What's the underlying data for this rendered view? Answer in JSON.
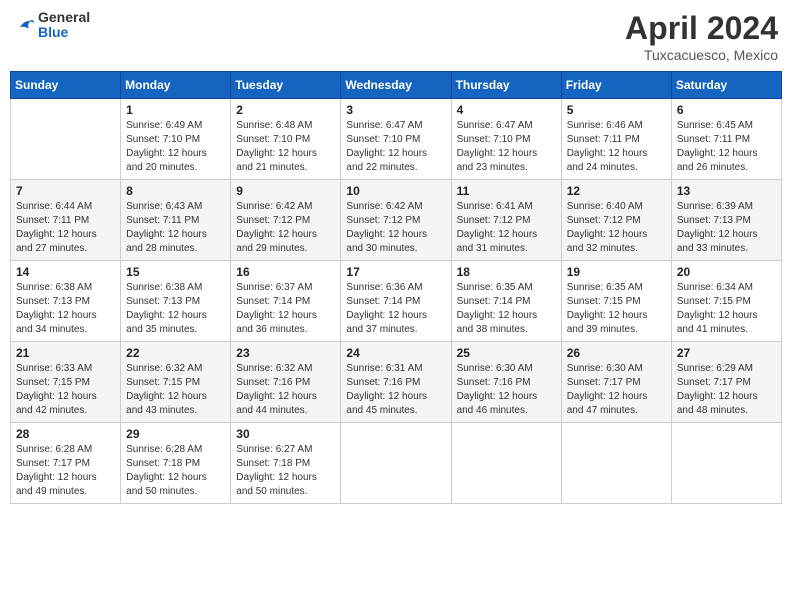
{
  "header": {
    "logo_general": "General",
    "logo_blue": "Blue",
    "month": "April 2024",
    "location": "Tuxcacuesco, Mexico"
  },
  "weekdays": [
    "Sunday",
    "Monday",
    "Tuesday",
    "Wednesday",
    "Thursday",
    "Friday",
    "Saturday"
  ],
  "weeks": [
    [
      {
        "day": "",
        "info": ""
      },
      {
        "day": "1",
        "info": "Sunrise: 6:49 AM\nSunset: 7:10 PM\nDaylight: 12 hours\nand 20 minutes."
      },
      {
        "day": "2",
        "info": "Sunrise: 6:48 AM\nSunset: 7:10 PM\nDaylight: 12 hours\nand 21 minutes."
      },
      {
        "day": "3",
        "info": "Sunrise: 6:47 AM\nSunset: 7:10 PM\nDaylight: 12 hours\nand 22 minutes."
      },
      {
        "day": "4",
        "info": "Sunrise: 6:47 AM\nSunset: 7:10 PM\nDaylight: 12 hours\nand 23 minutes."
      },
      {
        "day": "5",
        "info": "Sunrise: 6:46 AM\nSunset: 7:11 PM\nDaylight: 12 hours\nand 24 minutes."
      },
      {
        "day": "6",
        "info": "Sunrise: 6:45 AM\nSunset: 7:11 PM\nDaylight: 12 hours\nand 26 minutes."
      }
    ],
    [
      {
        "day": "7",
        "info": "Sunrise: 6:44 AM\nSunset: 7:11 PM\nDaylight: 12 hours\nand 27 minutes."
      },
      {
        "day": "8",
        "info": "Sunrise: 6:43 AM\nSunset: 7:11 PM\nDaylight: 12 hours\nand 28 minutes."
      },
      {
        "day": "9",
        "info": "Sunrise: 6:42 AM\nSunset: 7:12 PM\nDaylight: 12 hours\nand 29 minutes."
      },
      {
        "day": "10",
        "info": "Sunrise: 6:42 AM\nSunset: 7:12 PM\nDaylight: 12 hours\nand 30 minutes."
      },
      {
        "day": "11",
        "info": "Sunrise: 6:41 AM\nSunset: 7:12 PM\nDaylight: 12 hours\nand 31 minutes."
      },
      {
        "day": "12",
        "info": "Sunrise: 6:40 AM\nSunset: 7:12 PM\nDaylight: 12 hours\nand 32 minutes."
      },
      {
        "day": "13",
        "info": "Sunrise: 6:39 AM\nSunset: 7:13 PM\nDaylight: 12 hours\nand 33 minutes."
      }
    ],
    [
      {
        "day": "14",
        "info": "Sunrise: 6:38 AM\nSunset: 7:13 PM\nDaylight: 12 hours\nand 34 minutes."
      },
      {
        "day": "15",
        "info": "Sunrise: 6:38 AM\nSunset: 7:13 PM\nDaylight: 12 hours\nand 35 minutes."
      },
      {
        "day": "16",
        "info": "Sunrise: 6:37 AM\nSunset: 7:14 PM\nDaylight: 12 hours\nand 36 minutes."
      },
      {
        "day": "17",
        "info": "Sunrise: 6:36 AM\nSunset: 7:14 PM\nDaylight: 12 hours\nand 37 minutes."
      },
      {
        "day": "18",
        "info": "Sunrise: 6:35 AM\nSunset: 7:14 PM\nDaylight: 12 hours\nand 38 minutes."
      },
      {
        "day": "19",
        "info": "Sunrise: 6:35 AM\nSunset: 7:15 PM\nDaylight: 12 hours\nand 39 minutes."
      },
      {
        "day": "20",
        "info": "Sunrise: 6:34 AM\nSunset: 7:15 PM\nDaylight: 12 hours\nand 41 minutes."
      }
    ],
    [
      {
        "day": "21",
        "info": "Sunrise: 6:33 AM\nSunset: 7:15 PM\nDaylight: 12 hours\nand 42 minutes."
      },
      {
        "day": "22",
        "info": "Sunrise: 6:32 AM\nSunset: 7:15 PM\nDaylight: 12 hours\nand 43 minutes."
      },
      {
        "day": "23",
        "info": "Sunrise: 6:32 AM\nSunset: 7:16 PM\nDaylight: 12 hours\nand 44 minutes."
      },
      {
        "day": "24",
        "info": "Sunrise: 6:31 AM\nSunset: 7:16 PM\nDaylight: 12 hours\nand 45 minutes."
      },
      {
        "day": "25",
        "info": "Sunrise: 6:30 AM\nSunset: 7:16 PM\nDaylight: 12 hours\nand 46 minutes."
      },
      {
        "day": "26",
        "info": "Sunrise: 6:30 AM\nSunset: 7:17 PM\nDaylight: 12 hours\nand 47 minutes."
      },
      {
        "day": "27",
        "info": "Sunrise: 6:29 AM\nSunset: 7:17 PM\nDaylight: 12 hours\nand 48 minutes."
      }
    ],
    [
      {
        "day": "28",
        "info": "Sunrise: 6:28 AM\nSunset: 7:17 PM\nDaylight: 12 hours\nand 49 minutes."
      },
      {
        "day": "29",
        "info": "Sunrise: 6:28 AM\nSunset: 7:18 PM\nDaylight: 12 hours\nand 50 minutes."
      },
      {
        "day": "30",
        "info": "Sunrise: 6:27 AM\nSunset: 7:18 PM\nDaylight: 12 hours\nand 50 minutes."
      },
      {
        "day": "",
        "info": ""
      },
      {
        "day": "",
        "info": ""
      },
      {
        "day": "",
        "info": ""
      },
      {
        "day": "",
        "info": ""
      }
    ]
  ]
}
